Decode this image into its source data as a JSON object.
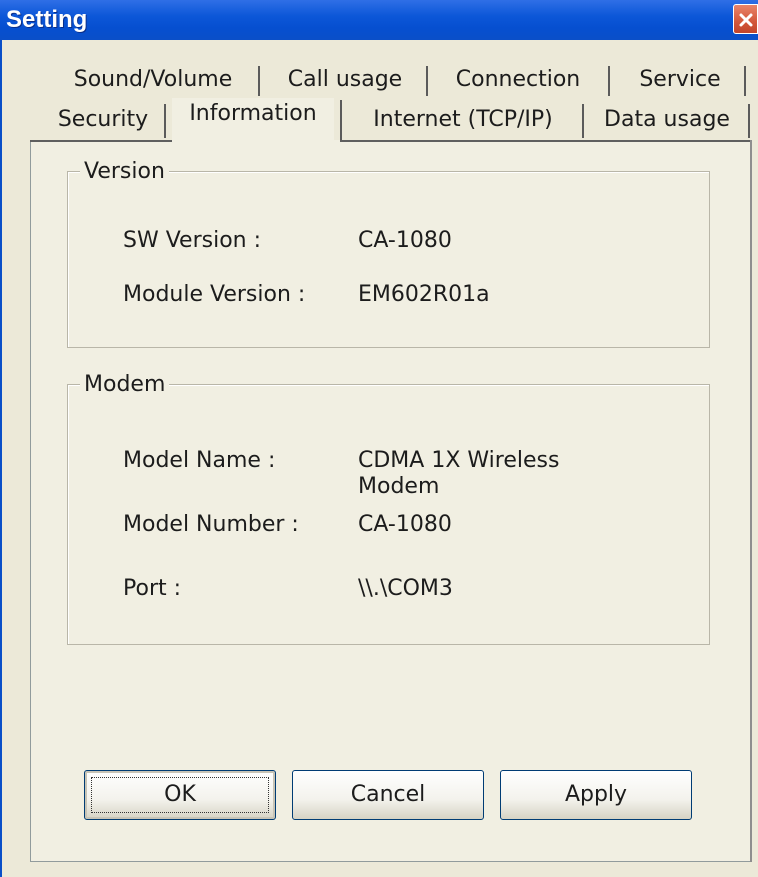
{
  "window": {
    "title": "Setting",
    "close_icon": "close-x-icon",
    "colors": {
      "titlebar": "#0a4fc8",
      "close": "#d3573a",
      "face": "#ece9d8"
    }
  },
  "tabs": {
    "row1": [
      "Sound/Volume",
      "Call usage",
      "Connection",
      "Service"
    ],
    "row2": [
      "Security",
      "Information",
      "Internet (TCP/IP)",
      "Data usage"
    ],
    "active": "Information"
  },
  "version_group": {
    "legend": "Version",
    "sw_label": "SW Version :",
    "sw_value": "CA-1080",
    "module_label": "Module Version :",
    "module_value": "EM602R01a"
  },
  "modem_group": {
    "legend": "Modem",
    "model_name_label": "Model Name :",
    "model_name_value": "CDMA 1X Wireless Modem",
    "model_number_label": "Model Number :",
    "model_number_value": "CA-1080",
    "port_label": "Port :",
    "port_value": "\\\\.\\COM3"
  },
  "buttons": {
    "ok": "OK",
    "cancel": "Cancel",
    "apply": "Apply"
  }
}
